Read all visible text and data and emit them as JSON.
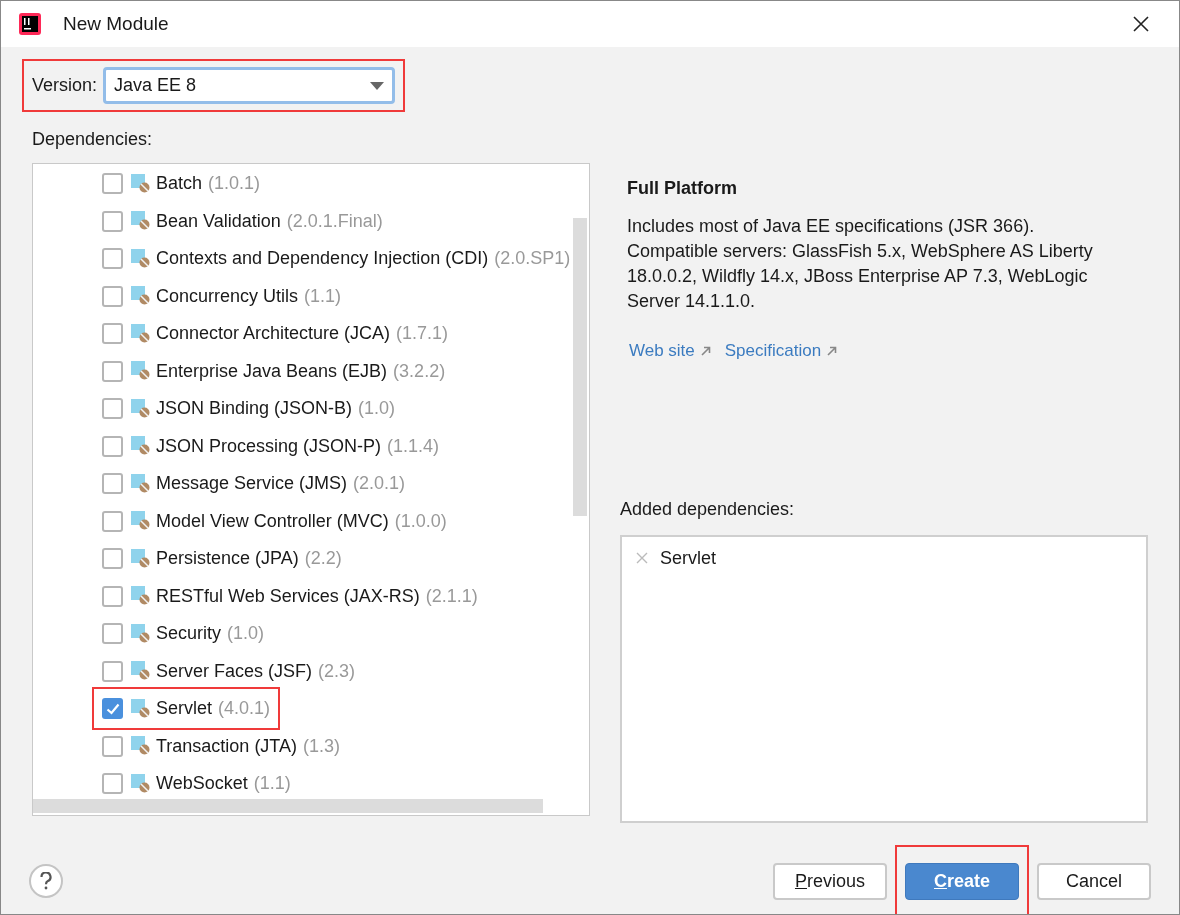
{
  "window": {
    "title": "New Module"
  },
  "version": {
    "label": "Version:",
    "value": "Java EE 8",
    "highlighted": true
  },
  "dependencies_label": "Dependencies:",
  "dependencies": [
    {
      "name": "Batch",
      "version": "(1.0.1)",
      "checked": false,
      "highlighted": false
    },
    {
      "name": "Bean Validation",
      "version": "(2.0.1.Final)",
      "checked": false,
      "highlighted": false
    },
    {
      "name": "Contexts and Dependency Injection (CDI)",
      "version": "(2.0.SP1)",
      "checked": false,
      "highlighted": false
    },
    {
      "name": "Concurrency Utils",
      "version": "(1.1)",
      "checked": false,
      "highlighted": false
    },
    {
      "name": "Connector Architecture (JCA)",
      "version": "(1.7.1)",
      "checked": false,
      "highlighted": false
    },
    {
      "name": "Enterprise Java Beans (EJB)",
      "version": "(3.2.2)",
      "checked": false,
      "highlighted": false
    },
    {
      "name": "JSON Binding (JSON-B)",
      "version": "(1.0)",
      "checked": false,
      "highlighted": false
    },
    {
      "name": "JSON Processing (JSON-P)",
      "version": "(1.1.4)",
      "checked": false,
      "highlighted": false
    },
    {
      "name": "Message Service (JMS)",
      "version": "(2.0.1)",
      "checked": false,
      "highlighted": false
    },
    {
      "name": "Model View Controller (MVC)",
      "version": "(1.0.0)",
      "checked": false,
      "highlighted": false
    },
    {
      "name": "Persistence (JPA)",
      "version": "(2.2)",
      "checked": false,
      "highlighted": false
    },
    {
      "name": "RESTful Web Services (JAX-RS)",
      "version": "(2.1.1)",
      "checked": false,
      "highlighted": false
    },
    {
      "name": "Security",
      "version": "(1.0)",
      "checked": false,
      "highlighted": false
    },
    {
      "name": "Server Faces (JSF)",
      "version": "(2.3)",
      "checked": false,
      "highlighted": false
    },
    {
      "name": "Servlet",
      "version": "(4.0.1)",
      "checked": true,
      "highlighted": true
    },
    {
      "name": "Transaction (JTA)",
      "version": "(1.3)",
      "checked": false,
      "highlighted": false
    },
    {
      "name": "WebSocket",
      "version": "(1.1)",
      "checked": false,
      "highlighted": false
    }
  ],
  "details": {
    "title": "Full Platform",
    "description": "Includes most of Java EE specifications (JSR 366). Compatible servers: GlassFish 5.x, WebSphere AS Liberty 18.0.0.2, Wildfly 14.x, JBoss Enterprise AP 7.3, WebLogic Server 14.1.1.0.",
    "links": [
      "Web site",
      "Specification"
    ]
  },
  "added": {
    "label": "Added dependencies:",
    "items": [
      "Servlet"
    ]
  },
  "buttons": [
    {
      "label": "Previous",
      "primary": false,
      "mnemonic": true,
      "highlighted": false
    },
    {
      "label": "Create",
      "primary": true,
      "mnemonic": true,
      "highlighted": true
    },
    {
      "label": "Cancel",
      "primary": false,
      "mnemonic": false,
      "highlighted": false
    }
  ]
}
